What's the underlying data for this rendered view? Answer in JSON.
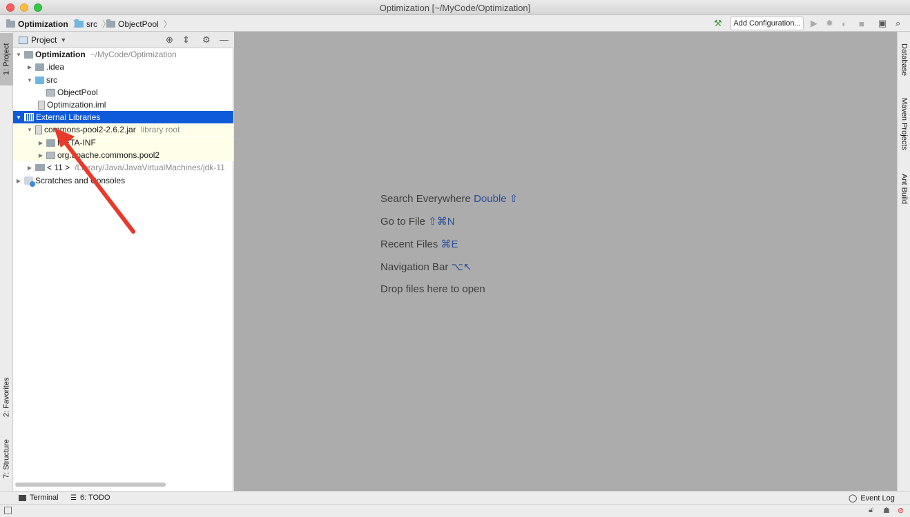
{
  "window": {
    "title": "Optimization [~/MyCode/Optimization]"
  },
  "breadcrumb": {
    "items": [
      "Optimization",
      "src",
      "ObjectPool"
    ]
  },
  "toolbar": {
    "add_configuration": "Add Configuration...",
    "icons": [
      "hammer-icon",
      "run-icon",
      "debug-icon",
      "coverage-icon",
      "stop-icon",
      "project-structure-icon",
      "search-icon"
    ]
  },
  "left_tabs": {
    "project": "1: Project",
    "favorites": "2: Favorites",
    "structure": "7: Structure"
  },
  "right_tabs": {
    "database": "Database",
    "maven": "Maven Projects",
    "ant": "Ant Build"
  },
  "project_panel": {
    "title": "Project",
    "tree": [
      {
        "label": "Optimization",
        "extra": "~/MyCode/Optimization"
      },
      {
        "label": ".idea"
      },
      {
        "label": "src"
      },
      {
        "label": "ObjectPool"
      },
      {
        "label": "Optimization.iml"
      },
      {
        "label": "External Libraries"
      },
      {
        "label": "commons-pool2-2.6.2.jar",
        "extra": "library root"
      },
      {
        "label": "META-INF"
      },
      {
        "label": "org.apache.commons.pool2"
      },
      {
        "label": "< 11 >",
        "extra": "/Library/Java/JavaVirtualMachines/jdk-11"
      },
      {
        "label": "Scratches and Consoles"
      }
    ]
  },
  "editor": {
    "hints": [
      {
        "text": "Search Everywhere",
        "key": "Double ⇧"
      },
      {
        "text": "Go to File",
        "key": "⇧⌘N"
      },
      {
        "text": "Recent Files",
        "key": "⌘E"
      },
      {
        "text": "Navigation Bar",
        "key": "⌥↖"
      },
      {
        "text": "Drop files here to open",
        "key": ""
      }
    ]
  },
  "bottom": {
    "terminal": "Terminal",
    "todo": "6: TODO",
    "event_log": "Event Log"
  },
  "colors": {
    "selection": "#0f5ad9",
    "editor_bg": "#acacac",
    "annotation": "#e8392b"
  }
}
